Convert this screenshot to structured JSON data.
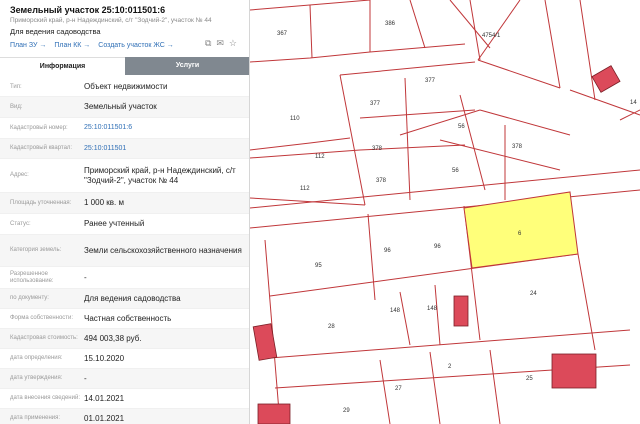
{
  "header": {
    "title": "Земельный участок 25:10:011501:6",
    "address": "Приморский край, р-н Надеждинский, с/т \"Зодчий-2\", участок № 44",
    "purpose": "Для ведения садоводства",
    "links": [
      "План ЗУ →",
      "План КК →",
      "Создать участок ЖС →"
    ]
  },
  "tabs": {
    "info": "Информация",
    "services": "Услуги"
  },
  "rows": [
    {
      "label": "Тип:",
      "value": "Объект недвижимости"
    },
    {
      "label": "Вид:",
      "value": "Земельный участок"
    },
    {
      "label": "Кадастровый номер:",
      "value": "25:10:011501:6"
    },
    {
      "label": "Кадастровый квартал:",
      "value": "25:10:011501"
    },
    {
      "label": "Адрес:",
      "value": "Приморский край, р-н Надеждинский, с/т \"Зодчий-2\", участок № 44"
    },
    {
      "label": "Площадь уточненная:",
      "value": "1 000 кв. м"
    },
    {
      "label": "Статус:",
      "value": "Ранее учтенный"
    },
    {
      "label": "Категория земель:",
      "value": "Земли сельскохозяйственного назначения"
    },
    {
      "label": "Разрешенное использование:",
      "value": "-"
    },
    {
      "label": "по документу:",
      "value": "Для ведения садоводства"
    },
    {
      "label": "Форма собственности:",
      "value": "Частная собственность"
    },
    {
      "label": "Кадастровая стоимость:",
      "value": "494 003,38 руб."
    },
    {
      "label": "дата определения:",
      "value": "15.10.2020"
    },
    {
      "label": "дата утверждения:",
      "value": "-"
    },
    {
      "label": "дата внесения сведений:",
      "value": "14.01.2021"
    },
    {
      "label": "дата применения:",
      "value": "01.01.2021"
    }
  ],
  "map": {
    "line_color": "#c0373a",
    "highlight_fill": "#ffff7a",
    "highlight_label": "6",
    "parcel_labels": [
      "367",
      "386",
      "4754/1",
      "377",
      "377",
      "110",
      "56",
      "378",
      "112",
      "378",
      "56",
      "378",
      "112",
      "96",
      "95",
      "96",
      "24",
      "148",
      "148",
      "28",
      "2",
      "27",
      "25",
      "29",
      "14"
    ]
  }
}
